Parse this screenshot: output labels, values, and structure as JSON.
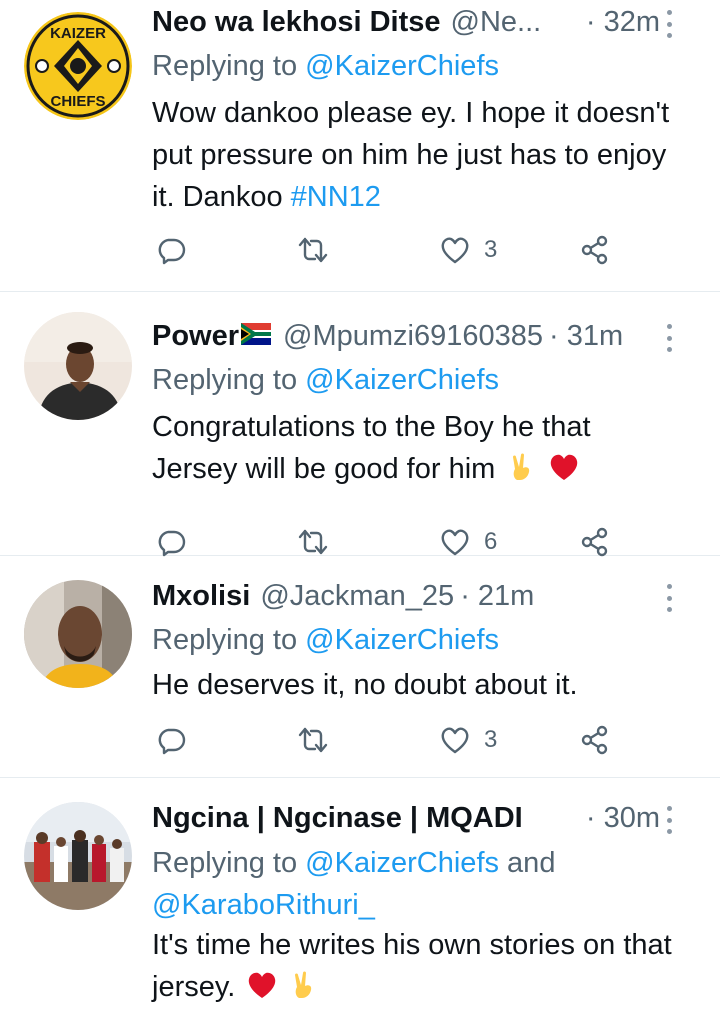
{
  "tweets": [
    {
      "name": "Neo wa lekhosi Ditse",
      "handle": "@Ne...",
      "time": "· 32m",
      "replying_prefix": "Replying to ",
      "replying_to": "@KaizerChiefs",
      "text_line1": "Wow dankoo please ey. I hope it doesn't",
      "text_line2": "put pressure on him he just has to enjoy",
      "text_line3_prefix": "it. Dankoo ",
      "hashtag": "#NN12",
      "likes": "3",
      "avatar_logo_top": "KAIZER",
      "avatar_logo_bottom": "CHIEFS"
    },
    {
      "name": "Power",
      "handle": "@Mpumzi69160385",
      "time": "· 31m",
      "replying_prefix": "Replying to ",
      "replying_to": "@KaizerChiefs",
      "text_line1": "Congratulations to the Boy he that",
      "text_line2": "Jersey will be good for him",
      "likes": "6"
    },
    {
      "name": "Mxolisi",
      "handle": "@Jackman_25",
      "time": "· 21m",
      "replying_prefix": "Replying to ",
      "replying_to": "@KaizerChiefs",
      "text_line1": "He deserves it, no doubt about it.",
      "likes": "3"
    },
    {
      "name": "Ngcina | Ngcinase | MQADI",
      "time": "· 30m",
      "replying_prefix": "Replying to ",
      "replying_to": "@KaizerChiefs",
      "replying_and": " and",
      "replying_to2": "@KaraboRithuri_",
      "text_line1": "It's time he writes his own stories on that",
      "text_line2": "jersey."
    }
  ],
  "icons": {
    "reply": "reply-icon",
    "retweet": "retweet-icon",
    "like": "heart-icon",
    "share": "share-icon",
    "more": "more-options-icon"
  },
  "colors": {
    "link": "#1d9bf0",
    "secondary_text": "#536471",
    "heart_emoji": "#e0122a"
  }
}
